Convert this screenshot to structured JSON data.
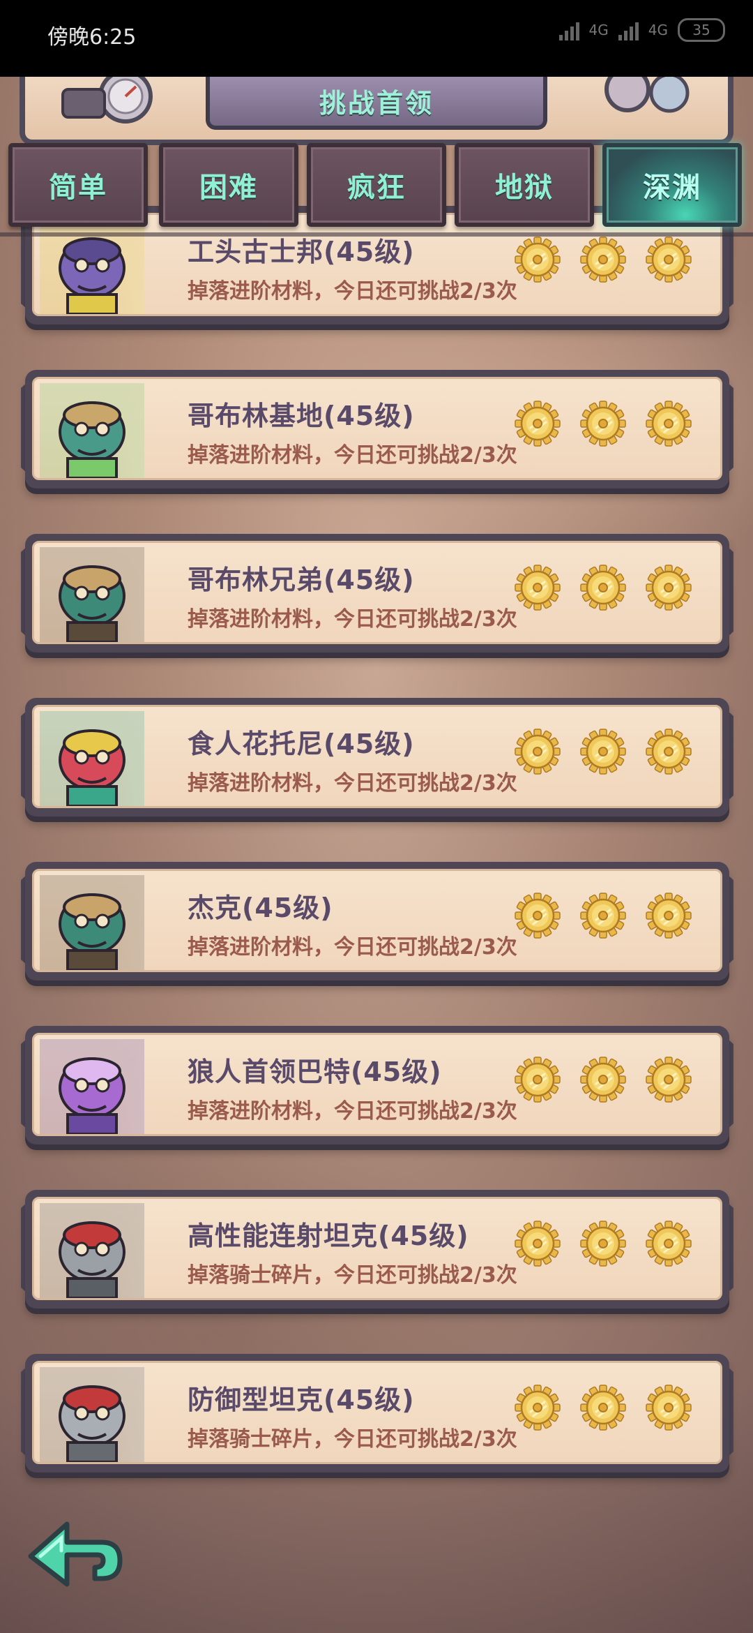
{
  "status_bar": {
    "time": "傍晚6:25",
    "network_1": "4G",
    "network_2": "4G",
    "battery": "35"
  },
  "header": {
    "title": "挑战首领"
  },
  "tabs": [
    {
      "label": "简单",
      "active": false
    },
    {
      "label": "困难",
      "active": false
    },
    {
      "label": "疯狂",
      "active": false
    },
    {
      "label": "地狱",
      "active": false
    },
    {
      "label": "深渊",
      "active": true
    }
  ],
  "bosses": [
    {
      "name": "工头古士邦(45级)",
      "desc": "掉落进阶材料，今日还可挑战2/3次",
      "portrait_icon": "purple-goblin-foreman-icon",
      "stars": 3
    },
    {
      "name": "哥布林基地(45级)",
      "desc": "掉落进阶材料，今日还可挑战2/3次",
      "portrait_icon": "goblin-base-icon",
      "stars": 3
    },
    {
      "name": "哥布林兄弟(45级)",
      "desc": "掉落进阶材料，今日还可挑战2/3次",
      "portrait_icon": "goblin-brothers-icon",
      "stars": 3
    },
    {
      "name": "食人花托尼(45级)",
      "desc": "掉落进阶材料，今日还可挑战2/3次",
      "portrait_icon": "maneater-flower-icon",
      "stars": 3
    },
    {
      "name": "杰克(45级)",
      "desc": "掉落进阶材料，今日还可挑战2/3次",
      "portrait_icon": "jack-goblin-icon",
      "stars": 3
    },
    {
      "name": "狼人首领巴特(45级)",
      "desc": "掉落进阶材料，今日还可挑战2/3次",
      "portrait_icon": "werewolf-leader-icon",
      "stars": 3
    },
    {
      "name": "高性能连射坦克(45级)",
      "desc": "掉落骑士碎片，今日还可挑战2/3次",
      "portrait_icon": "rapid-fire-tank-icon",
      "stars": 3
    },
    {
      "name": "防御型坦克(45级)",
      "desc": "掉落骑士碎片，今日还可挑战2/3次",
      "portrait_icon": "defense-tank-icon",
      "stars": 3
    }
  ],
  "colors": {
    "tab_text": "#8ff0d2",
    "name_text": "#5a4a6a",
    "desc_text": "#9a5a4c",
    "frame": "#4e4655",
    "gear_gold": "#e8b84a"
  },
  "back_button_icon": "back-arrow-icon"
}
